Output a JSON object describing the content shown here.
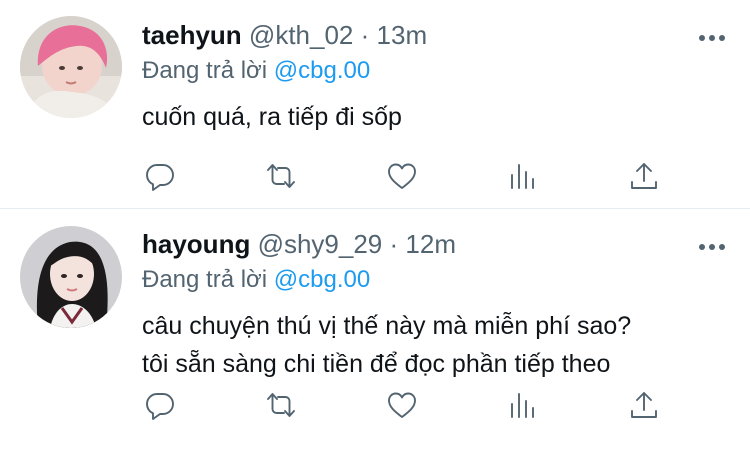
{
  "replies": [
    {
      "display_name": "taehyun",
      "handle": "@kth_02",
      "separator": "·",
      "time": "13m",
      "reply_prefix": "Đang trả lời",
      "reply_to": "@cbg.00",
      "text_lines": [
        "cuốn quá, ra tiếp đi sốp"
      ],
      "avatar": "avatar-pink-hair"
    },
    {
      "display_name": "hayoung",
      "handle": "@shy9_29",
      "separator": "·",
      "time": "12m",
      "reply_prefix": "Đang trả lời",
      "reply_to": "@cbg.00",
      "text_lines": [
        "câu chuyện thú vị thế này mà miễn phí sao?",
        "tôi sẵn sàng chi tiền để đọc phần tiếp theo"
      ],
      "avatar": "avatar-dark-hair"
    }
  ],
  "icons": {
    "reply": "reply-icon",
    "retweet": "retweet-icon",
    "like": "heart-icon",
    "stats": "bar-chart-icon",
    "share": "share-icon",
    "more": "more-dots-icon"
  },
  "colors": {
    "text": "#0f1419",
    "secondary": "#536471",
    "link": "#1d9bf0",
    "divider": "#e6ecf0"
  }
}
